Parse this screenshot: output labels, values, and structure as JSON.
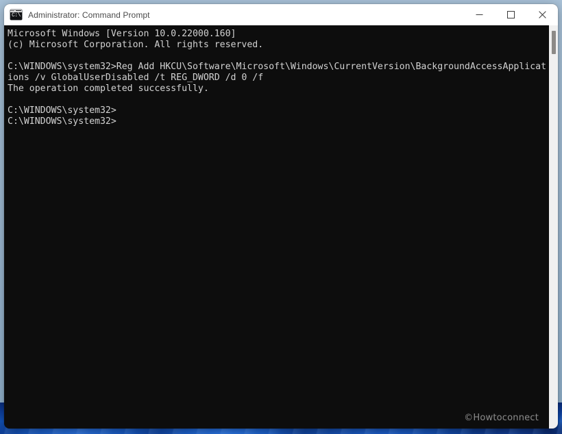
{
  "window": {
    "title": "Administrator: Command Prompt",
    "icon": "console-icon",
    "icon_glyph": "C:\\",
    "controls": {
      "minimize_label": "Minimize",
      "maximize_label": "Maximize",
      "close_label": "Close"
    }
  },
  "terminal": {
    "background_color": "#0d0d0d",
    "text_color": "#d2d2d2",
    "lines": [
      "Microsoft Windows [Version 10.0.22000.160]",
      "(c) Microsoft Corporation. All rights reserved.",
      "",
      "C:\\WINDOWS\\system32>Reg Add HKCU\\Software\\Microsoft\\Windows\\CurrentVersion\\BackgroundAccessApplicat",
      "ions /v GlobalUserDisabled /t REG_DWORD /d 0 /f",
      "The operation completed successfully.",
      "",
      "C:\\WINDOWS\\system32>",
      "C:\\WINDOWS\\system32>"
    ]
  },
  "scrollbar": {
    "track_color": "#f0f0f0",
    "thumb_color": "#8c8a87"
  },
  "watermark": {
    "text": "©Howtoconnect"
  }
}
